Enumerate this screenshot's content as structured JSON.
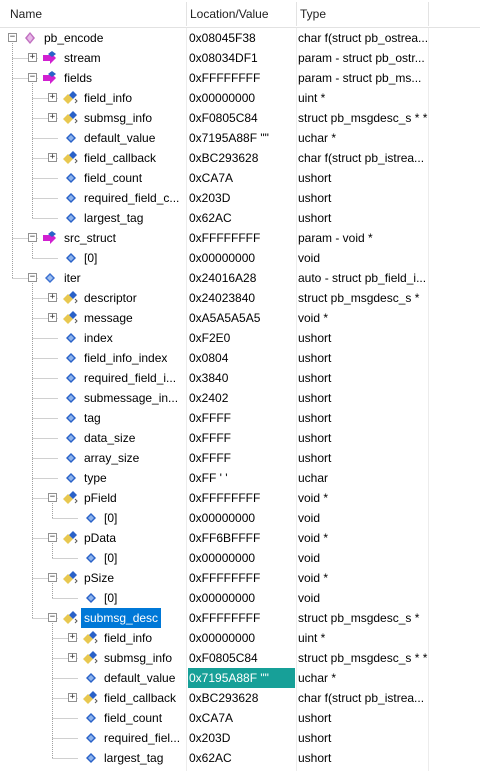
{
  "header": {
    "name": "Name",
    "location": "Location/Value",
    "type": "Type"
  },
  "rows": [
    {
      "depth": 0,
      "expander": "minus",
      "icon": "function-icon",
      "name": "pb_encode",
      "loc": "0x08045F38",
      "type": "char f(struct pb_ostrea..."
    },
    {
      "depth": 1,
      "expander": "plus",
      "icon": "param-icon",
      "name": "stream",
      "loc": "0x08034DF1",
      "type": "param - struct pb_ostr..."
    },
    {
      "depth": 1,
      "expander": "minus",
      "icon": "param-icon",
      "name": "fields",
      "loc": "0xFFFFFFFF",
      "type": "param - struct pb_ms..."
    },
    {
      "depth": 2,
      "expander": "plus",
      "icon": "pointer-icon",
      "name": "field_info",
      "loc": "0x00000000",
      "type": "uint *"
    },
    {
      "depth": 2,
      "expander": "plus",
      "icon": "pointer-icon",
      "name": "submsg_info",
      "loc": "0xF0805C84",
      "type": "struct pb_msgdesc_s * *"
    },
    {
      "depth": 2,
      "expander": "none",
      "icon": "member-icon",
      "name": "default_value",
      "loc": "0x7195A88F \"\"",
      "type": "uchar *"
    },
    {
      "depth": 2,
      "expander": "plus",
      "icon": "pointer-icon",
      "name": "field_callback",
      "loc": "0xBC293628",
      "type": "char f(struct pb_istrea..."
    },
    {
      "depth": 2,
      "expander": "none",
      "icon": "member-icon",
      "name": "field_count",
      "loc": "0xCA7A",
      "type": "ushort"
    },
    {
      "depth": 2,
      "expander": "none",
      "icon": "member-icon",
      "name": "required_field_c...",
      "loc": "0x203D",
      "type": "ushort"
    },
    {
      "depth": 2,
      "expander": "none",
      "icon": "member-icon",
      "name": "largest_tag",
      "loc": "0x62AC",
      "type": "ushort"
    },
    {
      "depth": 1,
      "expander": "minus",
      "icon": "param-icon",
      "name": "src_struct",
      "loc": "0xFFFFFFFF",
      "type": "param - void *"
    },
    {
      "depth": 2,
      "expander": "none",
      "icon": "member-icon",
      "name": "[0]",
      "loc": "0x00000000",
      "type": "void"
    },
    {
      "depth": 1,
      "expander": "minus",
      "icon": "auto-icon",
      "name": "iter",
      "loc": "0x24016A28",
      "type": "auto - struct pb_field_i..."
    },
    {
      "depth": 2,
      "expander": "plus",
      "icon": "pointer-icon",
      "name": "descriptor",
      "loc": "0x24023840",
      "type": "struct pb_msgdesc_s *"
    },
    {
      "depth": 2,
      "expander": "plus",
      "icon": "pointer-icon",
      "name": "message",
      "loc": "0xA5A5A5A5",
      "type": "void *"
    },
    {
      "depth": 2,
      "expander": "none",
      "icon": "member-icon",
      "name": "index",
      "loc": "0xF2E0",
      "type": "ushort"
    },
    {
      "depth": 2,
      "expander": "none",
      "icon": "member-icon",
      "name": "field_info_index",
      "loc": "0x0804",
      "type": "ushort"
    },
    {
      "depth": 2,
      "expander": "none",
      "icon": "member-icon",
      "name": "required_field_i...",
      "loc": "0x3840",
      "type": "ushort"
    },
    {
      "depth": 2,
      "expander": "none",
      "icon": "member-icon",
      "name": "submessage_in...",
      "loc": "0x2402",
      "type": "ushort"
    },
    {
      "depth": 2,
      "expander": "none",
      "icon": "member-icon",
      "name": "tag",
      "loc": "0xFFFF",
      "type": "ushort"
    },
    {
      "depth": 2,
      "expander": "none",
      "icon": "member-icon",
      "name": "data_size",
      "loc": "0xFFFF",
      "type": "ushort"
    },
    {
      "depth": 2,
      "expander": "none",
      "icon": "member-icon",
      "name": "array_size",
      "loc": "0xFFFF",
      "type": "ushort"
    },
    {
      "depth": 2,
      "expander": "none",
      "icon": "member-icon",
      "name": "type",
      "loc": "0xFF '   '",
      "type": "uchar"
    },
    {
      "depth": 2,
      "expander": "minus",
      "icon": "pointer-icon",
      "name": "pField",
      "loc": "0xFFFFFFFF",
      "type": "void *"
    },
    {
      "depth": 3,
      "expander": "none",
      "icon": "member-icon",
      "name": "[0]",
      "loc": "0x00000000",
      "type": "void"
    },
    {
      "depth": 2,
      "expander": "minus",
      "icon": "pointer-icon",
      "name": "pData",
      "loc": "0xFF6BFFFF",
      "type": "void *"
    },
    {
      "depth": 3,
      "expander": "none",
      "icon": "member-icon",
      "name": "[0]",
      "loc": "0x00000000",
      "type": "void"
    },
    {
      "depth": 2,
      "expander": "minus",
      "icon": "pointer-icon",
      "name": "pSize",
      "loc": "0xFFFFFFFF",
      "type": "void *"
    },
    {
      "depth": 3,
      "expander": "none",
      "icon": "member-icon",
      "name": "[0]",
      "loc": "0x00000000",
      "type": "void"
    },
    {
      "depth": 2,
      "expander": "minus",
      "icon": "pointer-icon",
      "name": "submsg_desc",
      "loc": "0xFFFFFFFF",
      "type": "struct pb_msgdesc_s *",
      "selected": true
    },
    {
      "depth": 3,
      "expander": "plus",
      "icon": "pointer-icon",
      "name": "field_info",
      "loc": "0x00000000",
      "type": "uint *"
    },
    {
      "depth": 3,
      "expander": "plus",
      "icon": "pointer-icon",
      "name": "submsg_info",
      "loc": "0xF0805C84",
      "type": "struct pb_msgdesc_s * *"
    },
    {
      "depth": 3,
      "expander": "none",
      "icon": "member-icon",
      "name": "default_value",
      "loc": "0x7195A88F \"\"",
      "type": "uchar *",
      "highlight": true
    },
    {
      "depth": 3,
      "expander": "plus",
      "icon": "pointer-icon",
      "name": "field_callback",
      "loc": "0xBC293628",
      "type": "char f(struct pb_istrea..."
    },
    {
      "depth": 3,
      "expander": "none",
      "icon": "member-icon",
      "name": "field_count",
      "loc": "0xCA7A",
      "type": "ushort"
    },
    {
      "depth": 3,
      "expander": "none",
      "icon": "member-icon",
      "name": "required_fiel...",
      "loc": "0x203D",
      "type": "ushort"
    },
    {
      "depth": 3,
      "expander": "none",
      "icon": "member-icon",
      "name": "largest_tag",
      "loc": "0x62AC",
      "type": "ushort"
    }
  ],
  "colors": {
    "selection": "#0078d7",
    "value_highlight": "#17a098",
    "function_icon": "#c070c0",
    "param_arrow": "#d020d0",
    "pointer_diamond": "#e8c850",
    "member_diamond": "#2a62c8"
  }
}
